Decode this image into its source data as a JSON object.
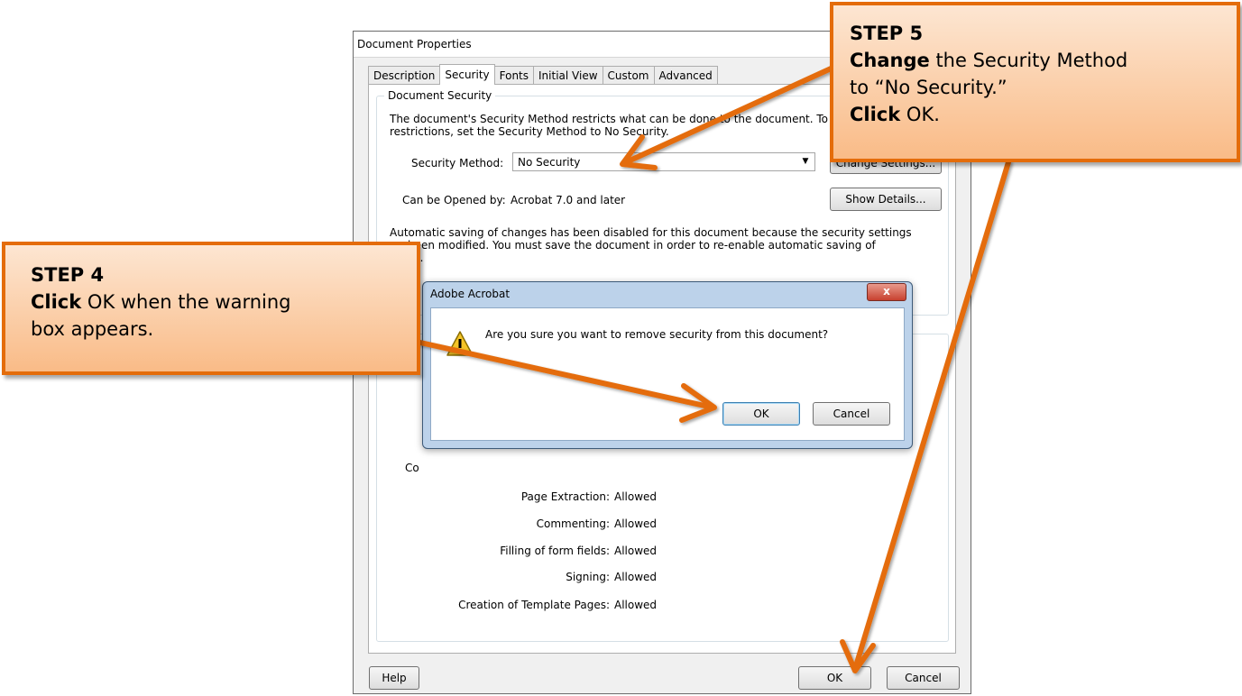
{
  "window": {
    "title": "Document Properties",
    "tabs": [
      "Description",
      "Security",
      "Fonts",
      "Initial View",
      "Custom",
      "Advanced"
    ],
    "active_tab": "Security"
  },
  "security": {
    "group_title": "Document Security",
    "description_line1": "The document's Security Method restricts what can be done to the document. To rem",
    "description_line2": "restrictions, set the Security Method to No Security.",
    "method_label": "Security Method:",
    "method_value": "No Security",
    "change_settings_label": "Change Settings...",
    "opened_by_label": "Can be Opened by:",
    "opened_by_value": "Acrobat 7.0 and later",
    "show_details_label": "Show Details...",
    "autosave_line1": "Automatic saving of changes has been disabled for this document because the security settings",
    "autosave_line2": "been modified. You must save the document in order to re-enable automatic saving of",
    "autosave_line3": "es."
  },
  "permissions": {
    "partial_label": "Co",
    "rows": [
      {
        "label": "Page Extraction:",
        "value": "Allowed"
      },
      {
        "label": "Commenting:",
        "value": "Allowed"
      },
      {
        "label": "Filling of form fields:",
        "value": "Allowed"
      },
      {
        "label": "Signing:",
        "value": "Allowed"
      },
      {
        "label": "Creation of Template Pages:",
        "value": "Allowed"
      }
    ]
  },
  "footer": {
    "help_label": "Help",
    "ok_label": "OK",
    "cancel_label": "Cancel"
  },
  "modal": {
    "title": "Adobe Acrobat",
    "close_label": "x",
    "message": "Are you sure you want to remove security from this document?",
    "ok_label": "OK",
    "cancel_label": "Cancel"
  },
  "callouts": {
    "step5": {
      "heading": "STEP 5",
      "line1_bold": "Change",
      "line1_rest": " the Security Method",
      "line2": "to “No Security.”",
      "line3_bold": "Click",
      "line3_rest": " OK."
    },
    "step4": {
      "heading": "STEP 4",
      "line1_bold": "Click",
      "line1_rest": " OK when the warning",
      "line2": "box appears."
    }
  },
  "colors": {
    "callout_border": "#e46c0a",
    "arrow": "#e46c0a",
    "callout_fill_top": "#fde6d2",
    "callout_fill_bottom": "#f9bb87"
  }
}
